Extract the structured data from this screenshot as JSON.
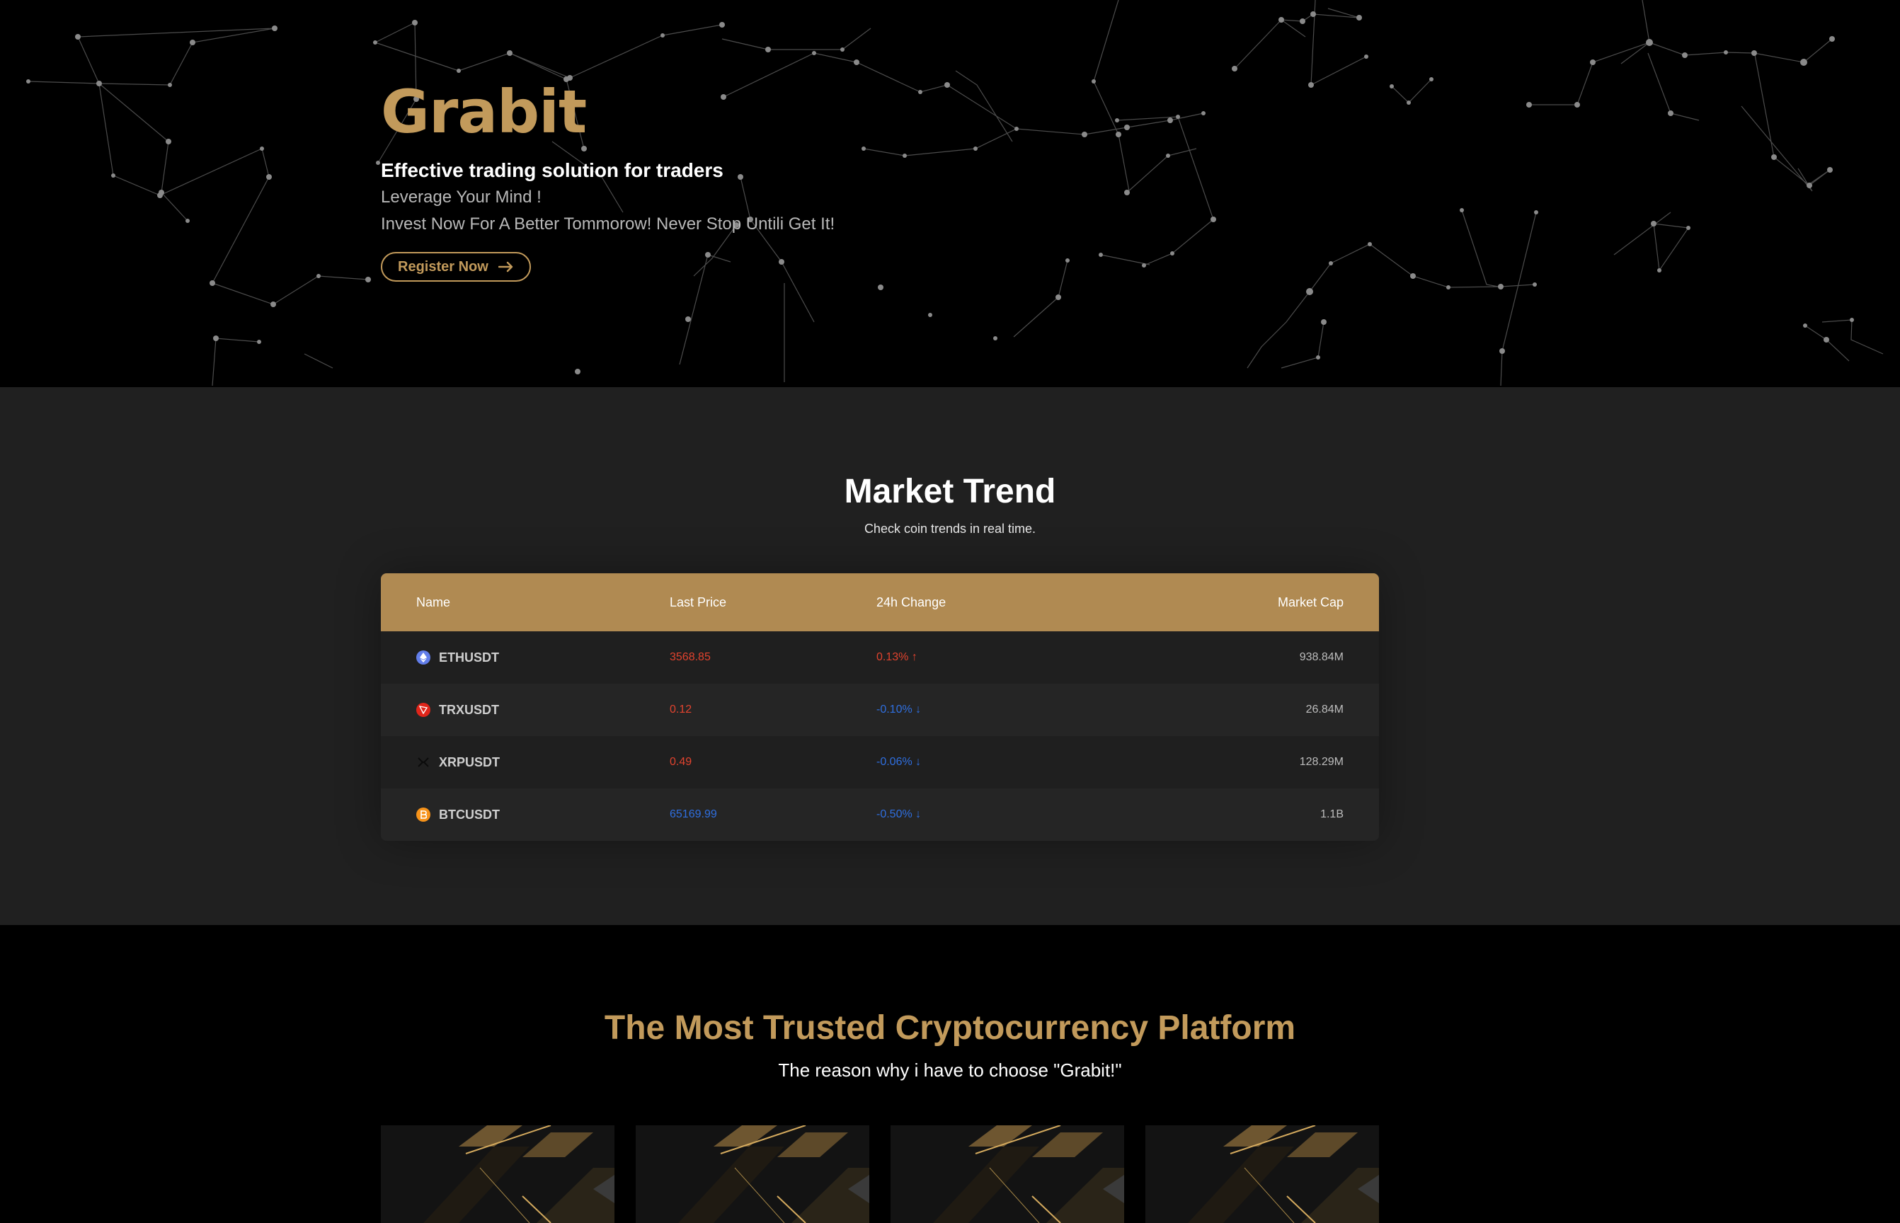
{
  "hero": {
    "brand": "Grabit",
    "tagline": "Effective trading solution for traders",
    "line1": "Leverage Your Mind !",
    "line2": "Invest Now For A Better Tommorow! Never Stop Untili Get It!",
    "register_label": "Register Now",
    "accent": "#c29a5b"
  },
  "market": {
    "title": "Market Trend",
    "subtitle": "Check coin trends in real time.",
    "columns": [
      "Name",
      "Last Price",
      "24h Change",
      "Market Cap"
    ],
    "rows": [
      {
        "icon": "eth-icon",
        "name": "ETHUSDT",
        "price": "3568.85",
        "change": "0.13% ↑",
        "cap": "938.84M",
        "dir": "up"
      },
      {
        "icon": "trx-icon",
        "name": "TRXUSDT",
        "price": "0.12",
        "change": "-0.10% ↓",
        "cap": "26.84M",
        "dir": "down"
      },
      {
        "icon": "xrp-icon",
        "name": "XRPUSDT",
        "price": "0.49",
        "change": "-0.06% ↓",
        "cap": "128.29M",
        "dir": "down"
      },
      {
        "icon": "btc-icon",
        "name": "BTCUSDT",
        "price": "65169.99",
        "change": "-0.50% ↓",
        "cap": "1.1B",
        "dir": "down"
      }
    ],
    "header_color": "#b08a52",
    "up_color": "#e2432e",
    "down_color": "#2f6fe0"
  },
  "trust": {
    "title": "The Most Trusted Cryptocurrency Platform",
    "subtitle": "The reason why i have to choose \"Grabit!\""
  }
}
